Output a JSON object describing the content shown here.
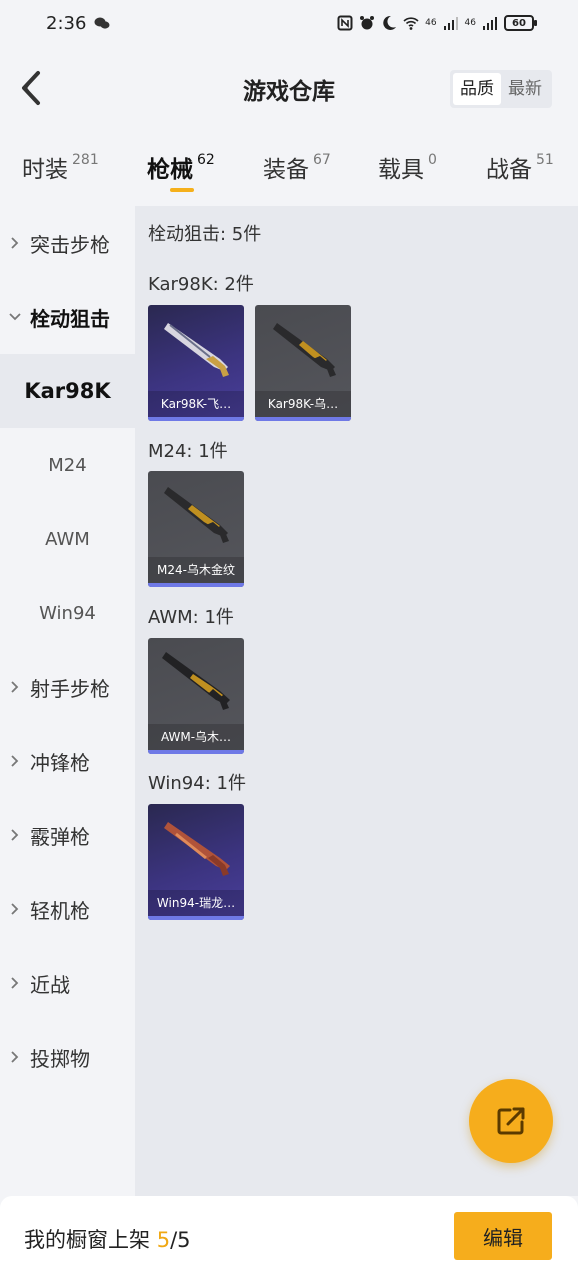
{
  "status_bar": {
    "time": "2:36",
    "network_left": "46",
    "network_right": "46",
    "battery": "60"
  },
  "header": {
    "title": "游戏仓库",
    "sort_options": [
      "品质",
      "最新"
    ]
  },
  "tabs": [
    {
      "label": "时装",
      "count": "281"
    },
    {
      "label": "枪械",
      "count": "62"
    },
    {
      "label": "装备",
      "count": "67"
    },
    {
      "label": "载具",
      "count": "0"
    },
    {
      "label": "战备",
      "count": "51"
    }
  ],
  "sidebar": {
    "cat_assault": "突击步枪",
    "cat_bolt": "栓动狙击",
    "sub_kar98k": "Kar98K",
    "sub_m24": "M24",
    "sub_awm": "AWM",
    "sub_win94": "Win94",
    "cat_marksman": "射手步枪",
    "cat_smg": "冲锋枪",
    "cat_shotgun": "霰弹枪",
    "cat_lmg": "轻机枪",
    "cat_melee": "近战",
    "cat_throw": "投掷物"
  },
  "content": {
    "summary": "栓动狙击: 5件",
    "sec_kar98k": "Kar98K: 2件",
    "sec_m24": "M24: 1件",
    "sec_awm": "AWM: 1件",
    "sec_win94": "Win94: 1件",
    "items": {
      "kar1": "Kar98K-飞…",
      "kar2": "Kar98K-乌…",
      "m24": "M24-乌木金纹",
      "awm": "AWM-乌木…",
      "win94": "Win94-瑞龙…"
    }
  },
  "bottom": {
    "shelf_prefix": "我的橱窗上架 ",
    "shelf_current": "5",
    "shelf_total": "/5",
    "edit_label": "编辑"
  },
  "colors": {
    "accent": "#f6ad1c",
    "rarity_purple": "#3c3480",
    "rarity_stripe": "#6f79e6"
  }
}
